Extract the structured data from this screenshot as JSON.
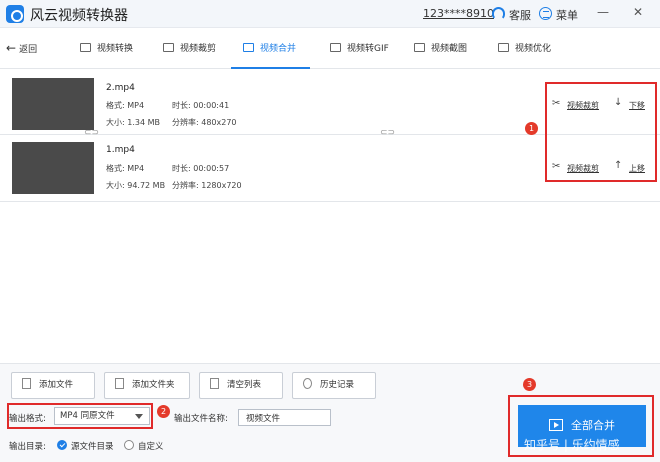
{
  "app": {
    "title": "风云视频转换器",
    "account": "123****8910",
    "service_label": "客服",
    "menu_label": "菜单",
    "minimize": "—",
    "close": "✕"
  },
  "toolbar": {
    "back_label": "返回",
    "tabs": [
      {
        "label": "视频转换",
        "icon": "video-convert-icon"
      },
      {
        "label": "视频裁剪",
        "icon": "video-crop-icon"
      },
      {
        "label": "视频合并",
        "icon": "video-merge-icon",
        "active": true
      },
      {
        "label": "视频转GIF",
        "icon": "gif-icon"
      },
      {
        "label": "视频截图",
        "icon": "screenshot-icon"
      },
      {
        "label": "视频优化",
        "icon": "optimize-icon"
      }
    ]
  },
  "files": [
    {
      "name": "2.mp4",
      "format": "格式: MP4",
      "duration": "时长: 00:00:41",
      "size": "大小: 1.34 MB",
      "resolution": "分辨率: 480x270",
      "crop_label": "视频裁剪",
      "move_label": "下移"
    },
    {
      "name": "1.mp4",
      "format": "格式: MP4",
      "duration": "时长: 00:00:57",
      "size": "大小: 94.72 MB",
      "resolution": "分辨率: 1280x720",
      "crop_label": "视频裁剪",
      "move_label": "上移"
    }
  ],
  "badges": [
    "1",
    "2",
    "3"
  ],
  "bottom": {
    "buttons": [
      "添加文件",
      "添加文件夹",
      "清空列表",
      "历史记录"
    ],
    "output_format_label": "输出格式:",
    "output_format_value": "MP4 同原文件",
    "output_name_label": "输出文件名称:",
    "output_name_value": "视频文件",
    "output_dir_label": "输出目录:",
    "dir_options": [
      "源文件目录",
      "自定义"
    ],
    "merge_button": "全部合并"
  },
  "watermark": "知乎号 | 乐约情感",
  "colors": {
    "accent": "#1f7fe6",
    "highlight": "#e02a2a"
  }
}
